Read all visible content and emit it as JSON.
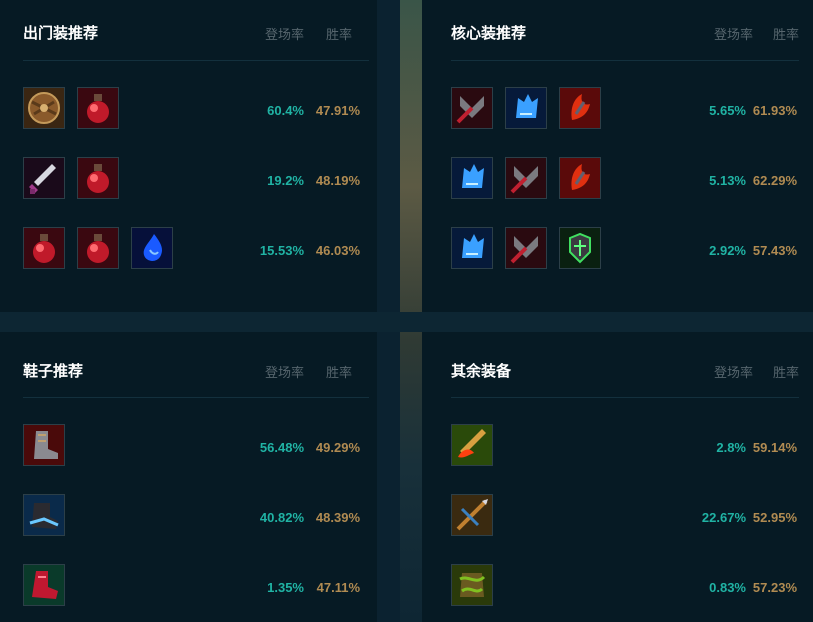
{
  "headers": {
    "pick_rate": "登场率",
    "win_rate": "胜率"
  },
  "starting_items": {
    "title": "出门装推荐",
    "rows": [
      {
        "icons": [
          "shield-icon",
          "potion-icon"
        ],
        "pick": "60.4%",
        "win": "47.91%"
      },
      {
        "icons": [
          "sword-icon",
          "potion-icon"
        ],
        "pick": "19.2%",
        "win": "48.19%"
      },
      {
        "icons": [
          "potion-icon",
          "potion-icon",
          "tear-icon"
        ],
        "pick": "15.53%",
        "win": "46.03%"
      }
    ]
  },
  "core_items": {
    "title": "核心装推荐",
    "rows": [
      {
        "icons": [
          "axe-icon",
          "ice-gauntlet-icon",
          "claw-icon"
        ],
        "pick": "5.65%",
        "win": "61.93%"
      },
      {
        "icons": [
          "ice-gauntlet-icon",
          "axe-icon",
          "claw-icon"
        ],
        "pick": "5.13%",
        "win": "62.29%"
      },
      {
        "icons": [
          "ice-gauntlet-icon",
          "axe-icon",
          "green-armor-icon"
        ],
        "pick": "2.92%",
        "win": "57.43%"
      }
    ]
  },
  "boots": {
    "title": "鞋子推荐",
    "rows": [
      {
        "icons": [
          "armored-boots-icon"
        ],
        "pick": "56.48%",
        "win": "49.29%"
      },
      {
        "icons": [
          "mercury-boots-icon"
        ],
        "pick": "40.82%",
        "win": "48.39%"
      },
      {
        "icons": [
          "red-boots-icon"
        ],
        "pick": "1.35%",
        "win": "47.11%"
      }
    ]
  },
  "other_items": {
    "title": "其余装备",
    "rows": [
      {
        "icons": [
          "flame-blade-icon"
        ],
        "pick": "2.8%",
        "win": "59.14%"
      },
      {
        "icons": [
          "crossbow-icon"
        ],
        "pick": "22.67%",
        "win": "52.95%"
      },
      {
        "icons": [
          "vine-armor-icon"
        ],
        "pick": "0.83%",
        "win": "57.23%"
      }
    ]
  }
}
